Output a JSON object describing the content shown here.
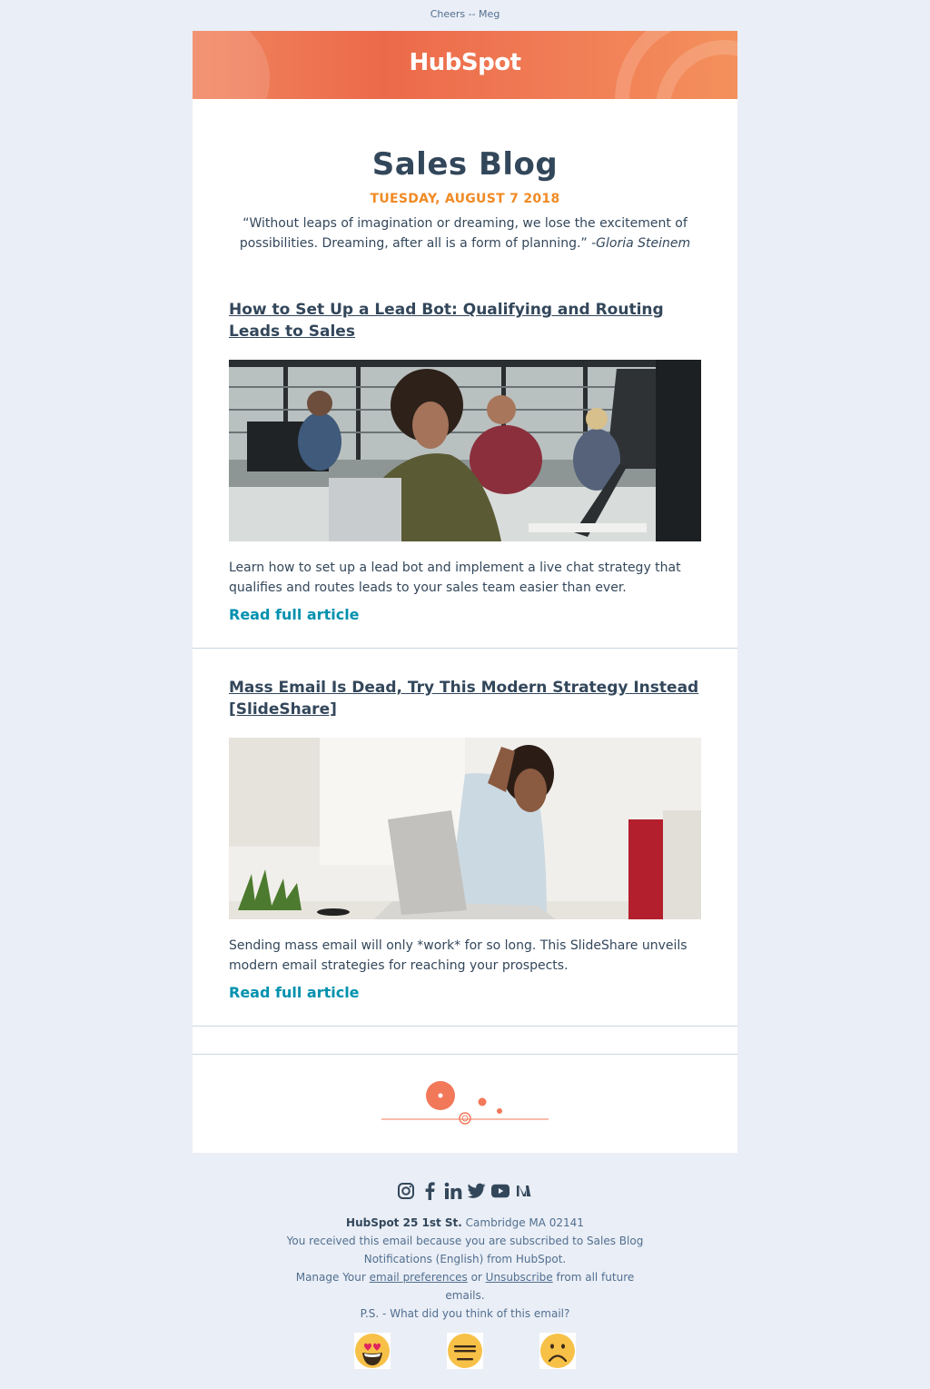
{
  "preheader": "Cheers -- Meg",
  "header": {
    "logo_text": "HubSpot"
  },
  "blog": {
    "title": "Sales Blog",
    "date": "TUESDAY, AUGUST 7 2018",
    "quote_text": "“Without leaps of imagination or dreaming, we lose the excitement of possibilities. Dreaming, after all is a form of planning.”",
    "quote_author": "-Gloria Steinem"
  },
  "articles": [
    {
      "title": "How to Set Up a Lead Bot: Qualifying and Routing Leads to Sales",
      "description": "Learn how to set up a lead bot and implement a live chat strategy that qualifies and routes leads to your sales team easier than ever.",
      "read_label": "Read full article"
    },
    {
      "title": "Mass Email Is Dead, Try This Modern Strategy Instead [SlideShare]",
      "description": "Sending mass email will only *work* for so long. This SlideShare unveils modern email strategies for reaching your prospects.",
      "read_label": "Read full article"
    }
  ],
  "social_icons": [
    "instagram-icon",
    "facebook-icon",
    "linkedin-icon",
    "twitter-icon",
    "youtube-icon",
    "medium-icon"
  ],
  "footer": {
    "company": "HubSpot 25 1st St.",
    "address": "Cambridge MA 02141",
    "subscription_text": "You received this email because you are subscribed to Sales Blog Notifications (English) from HubSpot.",
    "manage_prefix": "Manage Your",
    "preferences_link": "email preferences",
    "or_text": "or",
    "unsubscribe_link": "Unsubscribe",
    "manage_suffix": "from all future emails.",
    "ps_text": "P.S. - What did you think of this email?"
  },
  "feedback_icons": [
    "heart-eyes-emoji-icon",
    "neutral-face-emoji-icon",
    "frowning-face-emoji-icon"
  ],
  "colors": {
    "accent_orange": "#f08a24",
    "banner_orange": "#ec6a49",
    "link_teal": "#0091ae",
    "text_dark": "#33475b",
    "background": "#eaeef6"
  }
}
